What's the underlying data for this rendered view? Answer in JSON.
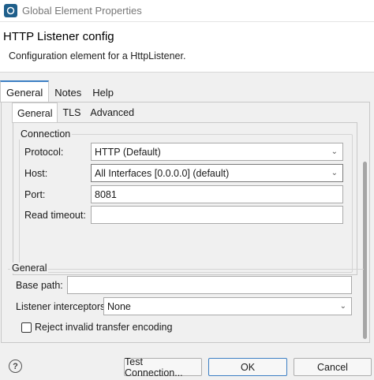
{
  "window": {
    "title": "Global Element Properties"
  },
  "header": {
    "title": "HTTP Listener config",
    "description": "Configuration element for a HttpListener."
  },
  "outer_tabs": [
    "General",
    "Notes",
    "Help"
  ],
  "inner_tabs": [
    "General",
    "TLS",
    "Advanced"
  ],
  "connection": {
    "group_label": "Connection",
    "protocol_label": "Protocol:",
    "protocol_value": "HTTP (Default)",
    "host_label": "Host:",
    "host_value": "All Interfaces [0.0.0.0] (default)",
    "port_label": "Port:",
    "port_value": "8081",
    "read_timeout_label": "Read timeout:",
    "read_timeout_value": ""
  },
  "general": {
    "group_label": "General",
    "base_path_label": "Base path:",
    "base_path_value": "",
    "interceptors_label": "Listener interceptors",
    "interceptors_value": "None",
    "reject_label": "Reject invalid transfer encoding",
    "reject_checked": false
  },
  "footer": {
    "help_glyph": "?",
    "test_connection": "Test Connection...",
    "ok": "OK",
    "cancel": "Cancel"
  }
}
